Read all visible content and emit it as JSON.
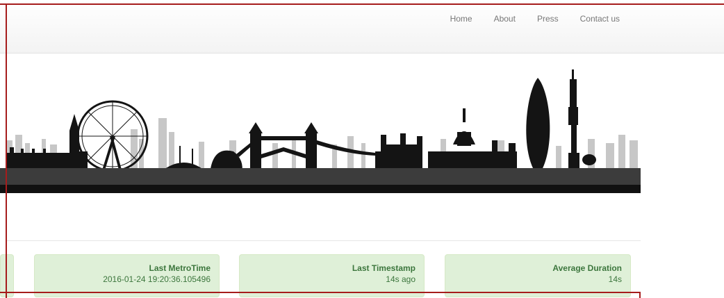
{
  "nav": {
    "items": [
      {
        "label": "Home"
      },
      {
        "label": "About"
      },
      {
        "label": "Press"
      },
      {
        "label": "Contact us"
      }
    ]
  },
  "stats": {
    "metrotime": {
      "title": "Last MetroTime",
      "value": "2016-01-24 19:20:36.105496"
    },
    "timestamp": {
      "title": "Last Timestamp",
      "value": "14s ago"
    },
    "duration": {
      "title": "Average Duration",
      "value": "14s"
    }
  },
  "colors": {
    "card_bg": "#dff0d8",
    "card_text": "#3c763d",
    "frame": "#a61c1c",
    "skyline_dark": "#111111",
    "skyline_grey": "#b5b5b5"
  }
}
